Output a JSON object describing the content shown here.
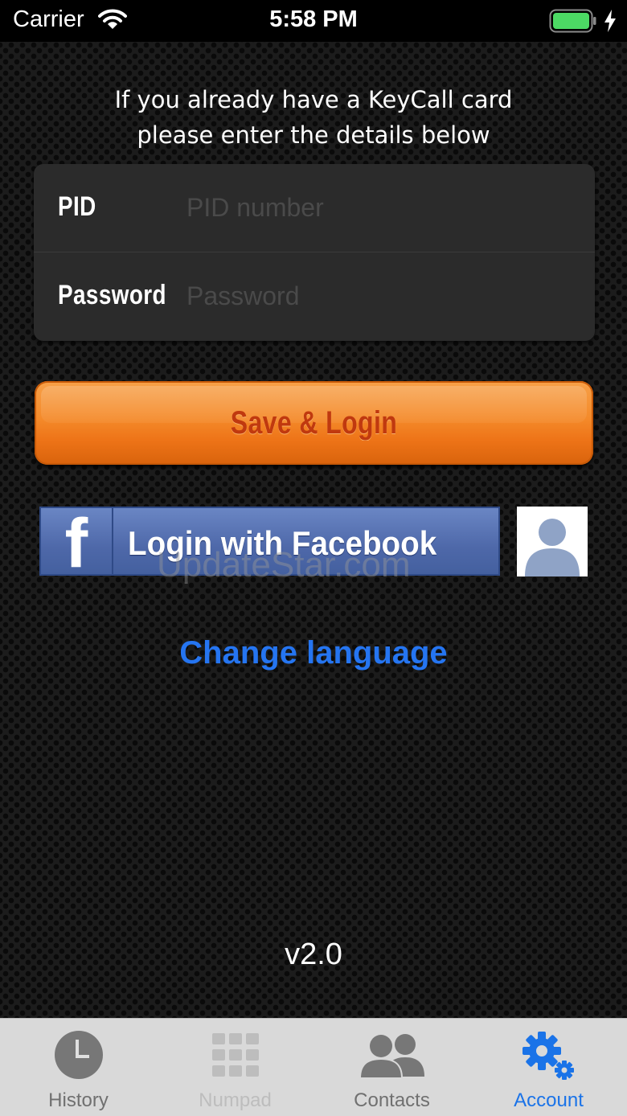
{
  "status_bar": {
    "carrier": "Carrier",
    "time": "5:58 PM"
  },
  "intro": {
    "line1": "If you already have a KeyCall card",
    "line2": "please enter the details below"
  },
  "form": {
    "pid_label": "PID",
    "pid_placeholder": "PID number",
    "password_label": "Password",
    "password_placeholder": "Password"
  },
  "save_button": {
    "label": "Save & Login"
  },
  "facebook_button": {
    "logo": "f",
    "label": "Login with Facebook"
  },
  "watermark": "UpdateStar.com",
  "change_language": "Change language",
  "version": "v2.0",
  "tab_bar": {
    "tabs": [
      {
        "label": "History",
        "icon": "clock-icon"
      },
      {
        "label": "Numpad",
        "icon": "numpad-icon"
      },
      {
        "label": "Contacts",
        "icon": "contacts-icon"
      },
      {
        "label": "Account",
        "icon": "gear-icon",
        "active": true
      }
    ]
  },
  "colors": {
    "accent": "#1a73e8",
    "link": "#2575f1",
    "save_button": "#f48a2a",
    "facebook": "#4e68a9"
  }
}
